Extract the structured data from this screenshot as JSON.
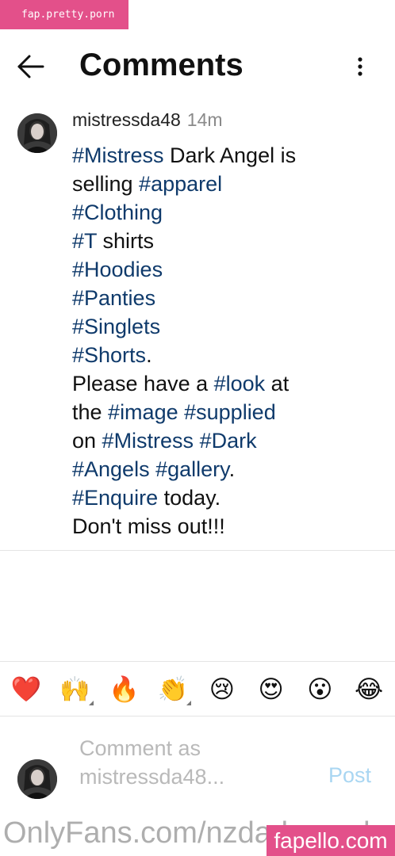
{
  "watermarks": {
    "top": "fap.pretty.porn",
    "bottom": "OnlyFans.com/nzdarkangel",
    "badge": "fapello.com"
  },
  "header": {
    "title": "Comments",
    "back_icon": "arrow-left-icon",
    "more_icon": "more-vertical-icon"
  },
  "comment": {
    "username": "mistressda48",
    "time": "14m",
    "lines": [
      [
        {
          "text": "#Mistress",
          "tag": true
        },
        {
          "text": " Dark Angel is",
          "tag": false
        }
      ],
      [
        {
          "text": "selling ",
          "tag": false
        },
        {
          "text": "#apparel",
          "tag": true
        }
      ],
      [
        {
          "text": "#Clothing",
          "tag": true
        }
      ],
      [
        {
          "text": "#T",
          "tag": true
        },
        {
          "text": " shirts",
          "tag": false
        }
      ],
      [
        {
          "text": "#Hoodies",
          "tag": true
        }
      ],
      [
        {
          "text": "#Panties",
          "tag": true
        }
      ],
      [
        {
          "text": "#Singlets",
          "tag": true
        }
      ],
      [
        {
          "text": "#Shorts",
          "tag": true
        },
        {
          "text": ".",
          "tag": false
        }
      ],
      [
        {
          "text": "Please have a ",
          "tag": false
        },
        {
          "text": "#look",
          "tag": true
        },
        {
          "text": " at",
          "tag": false
        }
      ],
      [
        {
          "text": "the ",
          "tag": false
        },
        {
          "text": "#image",
          "tag": true
        },
        {
          "text": " ",
          "tag": false
        },
        {
          "text": "#supplied",
          "tag": true
        }
      ],
      [
        {
          "text": "on ",
          "tag": false
        },
        {
          "text": "#Mistress",
          "tag": true
        },
        {
          "text": " ",
          "tag": false
        },
        {
          "text": "#Dark",
          "tag": true
        }
      ],
      [
        {
          "text": "#Angels",
          "tag": true
        },
        {
          "text": " ",
          "tag": false
        },
        {
          "text": "#gallery",
          "tag": true
        },
        {
          "text": ".",
          "tag": false
        }
      ],
      [
        {
          "text": "#Enquire",
          "tag": true
        },
        {
          "text": " today.",
          "tag": false
        }
      ],
      [
        {
          "text": "Don't miss out!!!",
          "tag": false
        }
      ]
    ]
  },
  "emoji_bar": [
    {
      "glyph": "❤️",
      "name": "red-heart",
      "variants": false
    },
    {
      "glyph": "🙌",
      "name": "raising-hands",
      "variants": true
    },
    {
      "glyph": "🔥",
      "name": "fire",
      "variants": false
    },
    {
      "glyph": "👏",
      "name": "clapping-hands",
      "variants": true
    },
    {
      "glyph": "😢",
      "name": "crying-face",
      "variants": false
    },
    {
      "glyph": "😍",
      "name": "heart-eyes",
      "variants": false
    },
    {
      "glyph": "😮",
      "name": "surprised-face",
      "variants": false
    },
    {
      "glyph": "😂",
      "name": "tears-of-joy",
      "variants": false
    }
  ],
  "composer": {
    "placeholder_line1": "Comment as",
    "placeholder_line2": "mistressda48...",
    "post_label": "Post"
  },
  "colors": {
    "hashtag": "#0f3a6b",
    "post_disabled": "#a9d6f2",
    "watermark_pink": "#e3508a"
  }
}
